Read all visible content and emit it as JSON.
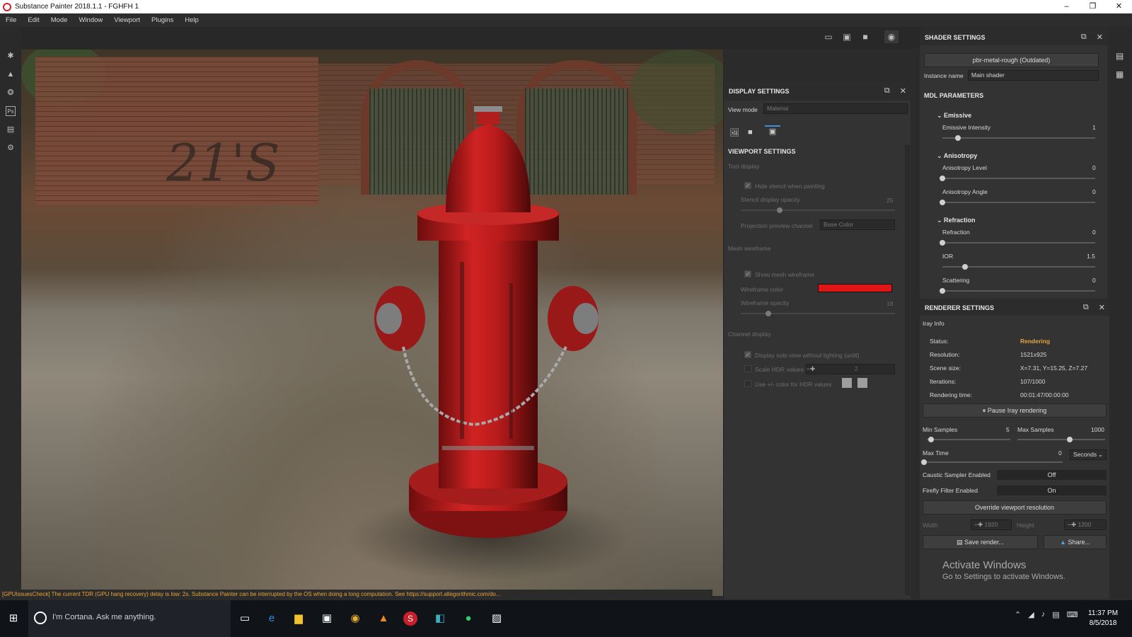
{
  "window": {
    "title": "Substance Painter 2018.1.1 - FGHFH 1",
    "controls": [
      "–",
      "❐",
      "✕"
    ]
  },
  "menu": [
    "File",
    "Edit",
    "Mode",
    "Window",
    "Viewport",
    "Plugins",
    "Help"
  ],
  "viewport_graffiti": "21'S",
  "status_message": "[GPUIssuesCheck] The current TDR (GPU hang recovery) delay is low: 2s. Substance Painter can be interrupted by the OS when doing a long computation. See https://support.allegorithmic.com/do...",
  "display_settings": {
    "title": "DISPLAY SETTINGS",
    "view_mode_label": "View mode",
    "view_mode_value": "Material",
    "viewport_settings_title": "VIEWPORT SETTINGS",
    "tool_display": "Tool display",
    "hide_stencil": "Hide stencil when painting",
    "stencil_opacity_label": "Stencil display opacity",
    "stencil_opacity_value": "25",
    "stencil_opacity_level": 0.25,
    "projection_label": "Projection preview channel",
    "projection_value": "Base Color",
    "mesh_wireframe": "Mesh wireframe",
    "show_wireframe": "Show mesh wireframe",
    "wireframe_color_label": "Wireframe color",
    "wireframe_color": "#e01616",
    "wireframe_opacity_label": "Wireframe opacity",
    "wireframe_opacity_value": "18",
    "wireframe_opacity_level": 0.18,
    "channel_display": "Channel display",
    "solo_view": "Display solo view without lighting (unlit)",
    "scale_hdr": "Scale HDR values",
    "scale_hdr_value": "2",
    "use_color_hdr": "Use +/- color for HDR values"
  },
  "shader_settings": {
    "title": "SHADER SETTINGS",
    "shader_button": "pbr-metal-rough (Outdated)",
    "instance_label": "Instance name",
    "instance_value": "Main shader",
    "mdl_title": "MDL PARAMETERS",
    "groups": {
      "emissive": "Emissive",
      "anisotropy": "Anisotropy",
      "refraction": "Refraction"
    },
    "params": {
      "emissive_intensity": {
        "label": "Emissive Intensity",
        "value": "1",
        "level": 0.1
      },
      "anisotropy_level": {
        "label": "Anisotropy Level",
        "value": "0",
        "level": 0.0
      },
      "anisotropy_angle": {
        "label": "Anisotropy Angle",
        "value": "0",
        "level": 0.0
      },
      "refraction": {
        "label": "Refraction",
        "value": "0",
        "level": 0.0
      },
      "ior": {
        "label": "IOR",
        "value": "1.5",
        "level": 0.15
      },
      "scattering": {
        "label": "Scattering",
        "value": "0",
        "level": 0.0
      }
    }
  },
  "renderer_settings": {
    "title": "RENDERER SETTINGS",
    "iray_info": "Iray Info",
    "status_label": "Status:",
    "status_value": "Rendering",
    "status_color": "#e8a33d",
    "resolution_label": "Resolution:",
    "resolution_value": "1521x925",
    "scene_size_label": "Scene size:",
    "scene_size_value": "X=7.31, Y=15.25, Z=7.27",
    "iterations_label": "Iterations:",
    "iterations_value": "107/1000",
    "rendering_time_label": "Rendering time:",
    "rendering_time_value": "00:01:47/00:00:00",
    "pause_button": "Pause Iray rendering",
    "min_samples_label": "Min Samples",
    "min_samples_value": "5",
    "min_samples_level": 0.05,
    "max_samples_label": "Max Samples",
    "max_samples_value": "1000",
    "max_samples_level": 0.6,
    "max_time_label": "Max Time",
    "max_time_value": "0",
    "max_time_level": 0.0,
    "time_unit": "Seconds",
    "caustic_label": "Caustic Sampler Enabled",
    "caustic_value": "Off",
    "firefly_label": "Firefly Filter Enabled",
    "firefly_value": "On",
    "override_button": "Override viewport resolution",
    "width_label": "Width",
    "width_value": "1920",
    "height_label": "Height",
    "height_value": "1200",
    "save_button": "Save render...",
    "share_button": "Share..."
  },
  "watermark": {
    "line1": "Activate Windows",
    "line2": "Go to Settings to activate Windows."
  },
  "taskbar": {
    "search_placeholder": "I'm Cortana. Ask me anything.",
    "time": "11:37 PM",
    "date": "8/5/2018"
  }
}
